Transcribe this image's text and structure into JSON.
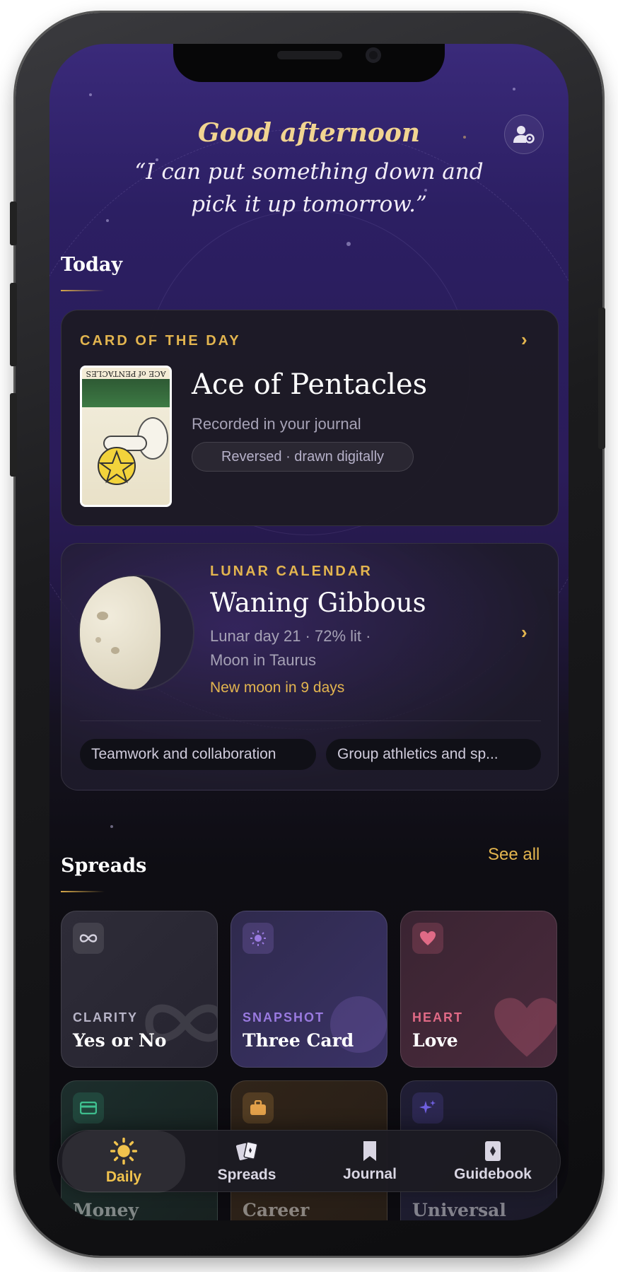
{
  "header": {
    "greeting": "Good afternoon",
    "quote": "“I can put something down and pick it up tomorrow.”"
  },
  "today": {
    "title": "Today"
  },
  "card_of_day": {
    "eyebrow": "CARD OF THE DAY",
    "card_label": "ACE of PENTACLES",
    "card_name": "Ace of Pentacles",
    "status": "Recorded in your journal",
    "badge": "Reversed · drawn digitally"
  },
  "lunar": {
    "eyebrow": "LUNAR CALENDAR",
    "phase": "Waning Gibbous",
    "detail_line1": "Lunar day 21 · 72% lit ·",
    "detail_line2": "Moon in Taurus",
    "next": "New moon in 9 days",
    "tags": [
      "Teamwork and collaboration",
      "Group athletics and sp..."
    ]
  },
  "spreads": {
    "title": "Spreads",
    "see_all": "See all",
    "items": [
      {
        "kicker": "CLARITY",
        "name": "Yes or No",
        "icon": "infinity-icon",
        "accent": "#b8b5c8"
      },
      {
        "kicker": "SNAPSHOT",
        "name": "Three Card",
        "icon": "sun-icon",
        "accent": "#9a7ae0"
      },
      {
        "kicker": "HEART",
        "name": "Love",
        "icon": "heart-icon",
        "accent": "#e06a86"
      },
      {
        "name": "Money",
        "icon": "card-icon",
        "accent": "#3fbf8f"
      },
      {
        "name": "Career",
        "icon": "briefcase-icon",
        "accent": "#e3a14a"
      },
      {
        "name": "Universal",
        "icon": "sparkles-icon",
        "accent": "#6f5fe0"
      }
    ]
  },
  "nav": {
    "items": [
      {
        "label": "Daily",
        "icon": "sun-icon",
        "active": true
      },
      {
        "label": "Spreads",
        "icon": "cards-icon"
      },
      {
        "label": "Journal",
        "icon": "bookmark-icon"
      },
      {
        "label": "Guidebook",
        "icon": "diamond-card-icon"
      }
    ]
  },
  "colors": {
    "gold": "#e3b54f",
    "background_top": "#3a2a7a",
    "background_bottom": "#0c0b10"
  }
}
